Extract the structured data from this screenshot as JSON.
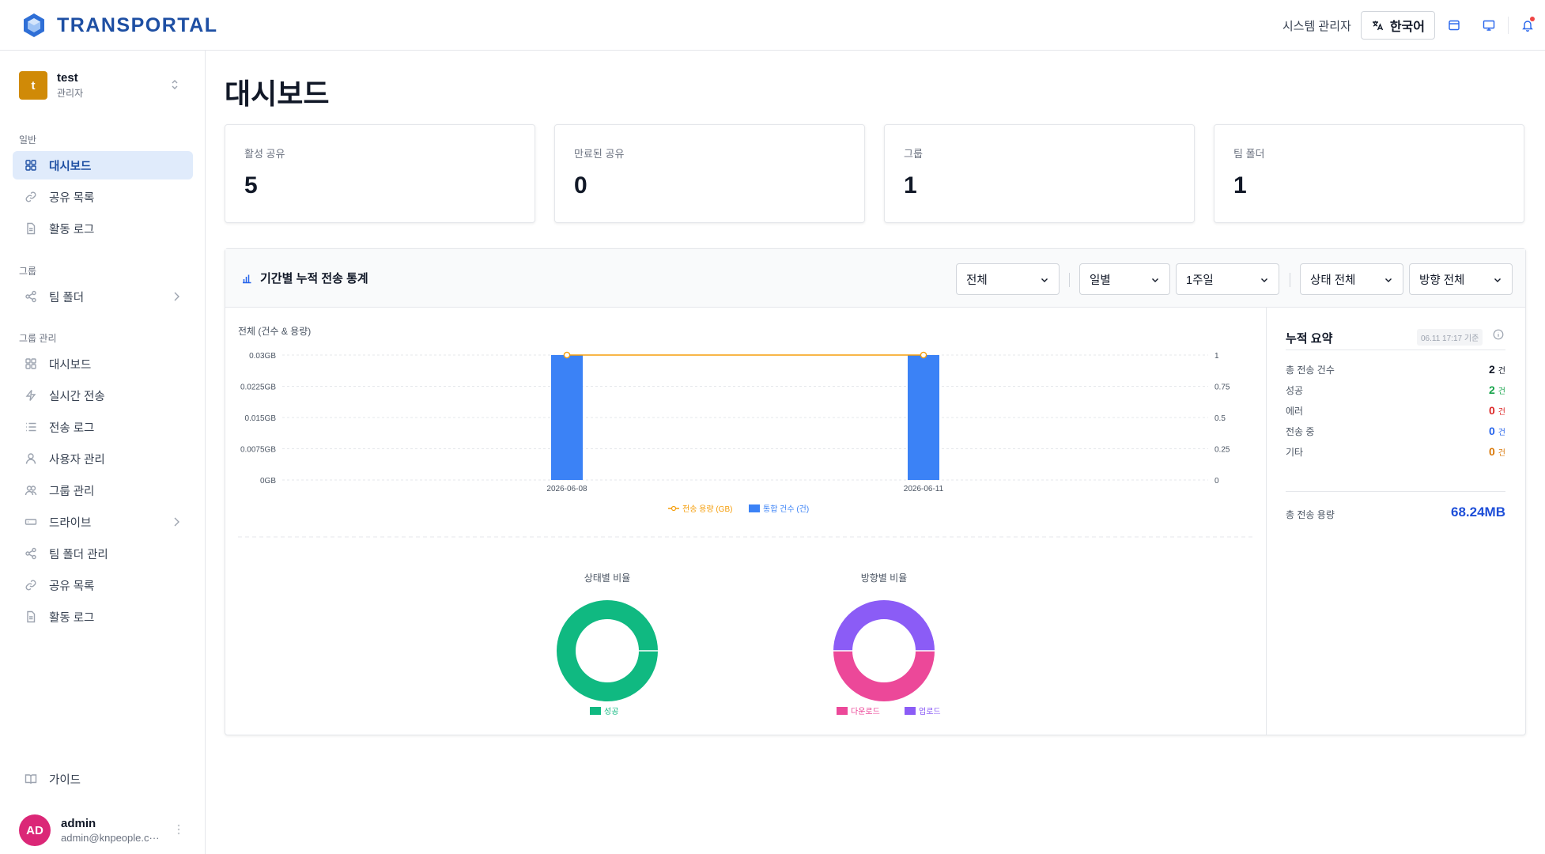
{
  "app": {
    "name": "TRANSPORTAL"
  },
  "header": {
    "system_admin": "시스템 관리자",
    "language": "한국어",
    "icons": [
      "layout-icon",
      "monitor-icon",
      "bell-icon"
    ]
  },
  "workspace": {
    "initial": "t",
    "name": "test",
    "role": "관리자"
  },
  "sidebar": {
    "sections": [
      {
        "title": "일반",
        "items": [
          {
            "label": "대시보드",
            "icon": "grid-icon",
            "active": true
          },
          {
            "label": "공유 목록",
            "icon": "link-icon"
          },
          {
            "label": "활동 로그",
            "icon": "file-icon"
          }
        ]
      },
      {
        "title": "그룹",
        "items": [
          {
            "label": "팀 폴더",
            "icon": "share-nodes-icon",
            "expandable": true
          }
        ]
      },
      {
        "title": "그룹 관리",
        "items": [
          {
            "label": "대시보드",
            "icon": "grid-icon"
          },
          {
            "label": "실시간 전송",
            "icon": "zap-icon"
          },
          {
            "label": "전송 로그",
            "icon": "list-icon"
          },
          {
            "label": "사용자 관리",
            "icon": "user-icon"
          },
          {
            "label": "그룹 관리",
            "icon": "users-icon"
          },
          {
            "label": "드라이브",
            "icon": "drive-icon",
            "expandable": true
          },
          {
            "label": "팀 폴더 관리",
            "icon": "share-nodes-icon"
          },
          {
            "label": "공유 목록",
            "icon": "link-icon"
          },
          {
            "label": "활동 로그",
            "icon": "file-icon"
          }
        ]
      }
    ],
    "guide": "가이드",
    "user": {
      "initials": "AD",
      "name": "admin",
      "email": "admin@knpeople.c···"
    }
  },
  "page": {
    "title": "대시보드"
  },
  "stats": [
    {
      "label": "활성 공유",
      "value": "5"
    },
    {
      "label": "만료된 공유",
      "value": "0"
    },
    {
      "label": "그룹",
      "value": "1"
    },
    {
      "label": "팀 폴더",
      "value": "1"
    }
  ],
  "panel": {
    "title": "기간별 누적 전송 통계",
    "filters": [
      "전체",
      "일별",
      "1주일",
      "상태 전체",
      "방향 전체"
    ]
  },
  "chart_data": [
    {
      "type": "bar",
      "title": "전체 (건수 & 용량)",
      "categories": [
        "2026-06-08",
        "2026-06-11"
      ],
      "y_ticks_left": [
        "0GB",
        "0.0075GB",
        "0.015GB",
        "0.0225GB",
        "0.03GB"
      ],
      "y_ticks_right": [
        "0",
        "0.25",
        "0.5",
        "0.75",
        "1"
      ],
      "ylim_left": [
        0,
        0.03
      ],
      "ylim_right": [
        0,
        1
      ],
      "grid": true,
      "legend_position": "bottom",
      "series": [
        {
          "name": "전송 용량 (GB)",
          "type": "line",
          "axis": "left",
          "color": "#f59e0b",
          "values": [
            0.03,
            0.03
          ]
        },
        {
          "name": "통합 건수 (건)",
          "type": "bar",
          "axis": "right",
          "color": "#3b82f6",
          "values": [
            1,
            1
          ]
        }
      ]
    },
    {
      "type": "pie",
      "title": "상태별 비율",
      "labels": [
        "성공"
      ],
      "values": [
        2
      ],
      "colors": [
        "#10b981"
      ],
      "legend_position": "bottom"
    },
    {
      "type": "pie",
      "title": "방향별 비율",
      "labels": [
        "다운로드",
        "업로드"
      ],
      "values": [
        1,
        1
      ],
      "colors": [
        "#ec4899",
        "#8b5cf6"
      ],
      "legend_position": "bottom"
    }
  ],
  "summary": {
    "title": "누적 요약",
    "as_of": "06.11 17:17 기준",
    "rows": [
      {
        "label": "총 전송 건수",
        "value": "2",
        "unit": "건",
        "color": "#111827"
      },
      {
        "label": "성공",
        "value": "2",
        "unit": "건",
        "color": "#16a34a"
      },
      {
        "label": "에러",
        "value": "0",
        "unit": "건",
        "color": "#dc2626"
      },
      {
        "label": "전송 중",
        "value": "0",
        "unit": "건",
        "color": "#2563eb"
      },
      {
        "label": "기타",
        "value": "0",
        "unit": "건",
        "color": "#d97706"
      }
    ],
    "total_label": "총 전송 용량",
    "total_value": "68.24MB"
  }
}
